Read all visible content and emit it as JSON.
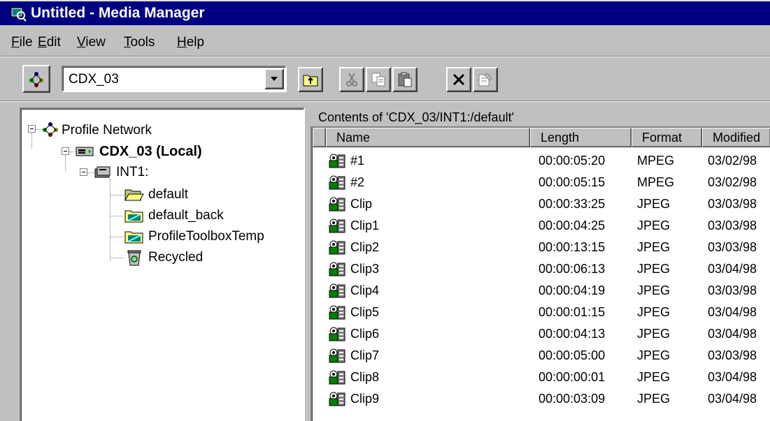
{
  "window": {
    "title": "Untitled - Media Manager",
    "icon": "media-manager-icon"
  },
  "menu": [
    {
      "label": "File",
      "mnemonic": "F",
      "rest": "ile"
    },
    {
      "label": "Edit",
      "mnemonic": "E",
      "rest": "dit"
    },
    {
      "label": "View",
      "mnemonic": "V",
      "rest": "iew"
    },
    {
      "label": "Tools",
      "mnemonic": "T",
      "rest": "ools"
    },
    {
      "label": "Help",
      "mnemonic": "H",
      "rest": "elp"
    }
  ],
  "toolbar": {
    "location_value": "CDX_03",
    "buttons": [
      "network-icon",
      "up-folder-icon",
      "cut-icon",
      "copy-icon",
      "paste-icon",
      "delete-icon",
      "properties-icon"
    ]
  },
  "tree": {
    "root": "Profile Network",
    "machine": "CDX_03 (Local)",
    "volume": "INT1:",
    "folders": [
      "default",
      "default_back",
      "ProfileToolboxTemp",
      "Recycled"
    ]
  },
  "contents": {
    "caption": "Contents of 'CDX_03/INT1:/default'",
    "columns": [
      "Name",
      "Length",
      "Format",
      "Modified"
    ],
    "rows": [
      {
        "name": "#1",
        "length": "00:00:05:20",
        "format": "MPEG",
        "modified": "03/02/98"
      },
      {
        "name": "#2",
        "length": "00:00:05:15",
        "format": "MPEG",
        "modified": "03/02/98"
      },
      {
        "name": "Clip",
        "length": "00:00:33:25",
        "format": "JPEG",
        "modified": "03/03/98"
      },
      {
        "name": "Clip1",
        "length": "00:00:04:25",
        "format": "JPEG",
        "modified": "03/03/98"
      },
      {
        "name": "Clip2",
        "length": "00:00:13:15",
        "format": "JPEG",
        "modified": "03/03/98"
      },
      {
        "name": "Clip3",
        "length": "00:00:06:13",
        "format": "JPEG",
        "modified": "03/04/98"
      },
      {
        "name": "Clip4",
        "length": "00:00:04:19",
        "format": "JPEG",
        "modified": "03/03/98"
      },
      {
        "name": "Clip5",
        "length": "00:00:01:15",
        "format": "JPEG",
        "modified": "03/04/98"
      },
      {
        "name": "Clip6",
        "length": "00:00:04:13",
        "format": "JPEG",
        "modified": "03/04/98"
      },
      {
        "name": "Clip7",
        "length": "00:00:05:00",
        "format": "JPEG",
        "modified": "03/03/98"
      },
      {
        "name": "Clip8",
        "length": "00:00:00:01",
        "format": "JPEG",
        "modified": "03/04/98"
      },
      {
        "name": "Clip9",
        "length": "00:00:03:09",
        "format": "JPEG",
        "modified": "03/04/98"
      }
    ]
  },
  "colors": {
    "titlebar": "#000080",
    "face": "#c0c0c0",
    "window": "#ffffff"
  }
}
